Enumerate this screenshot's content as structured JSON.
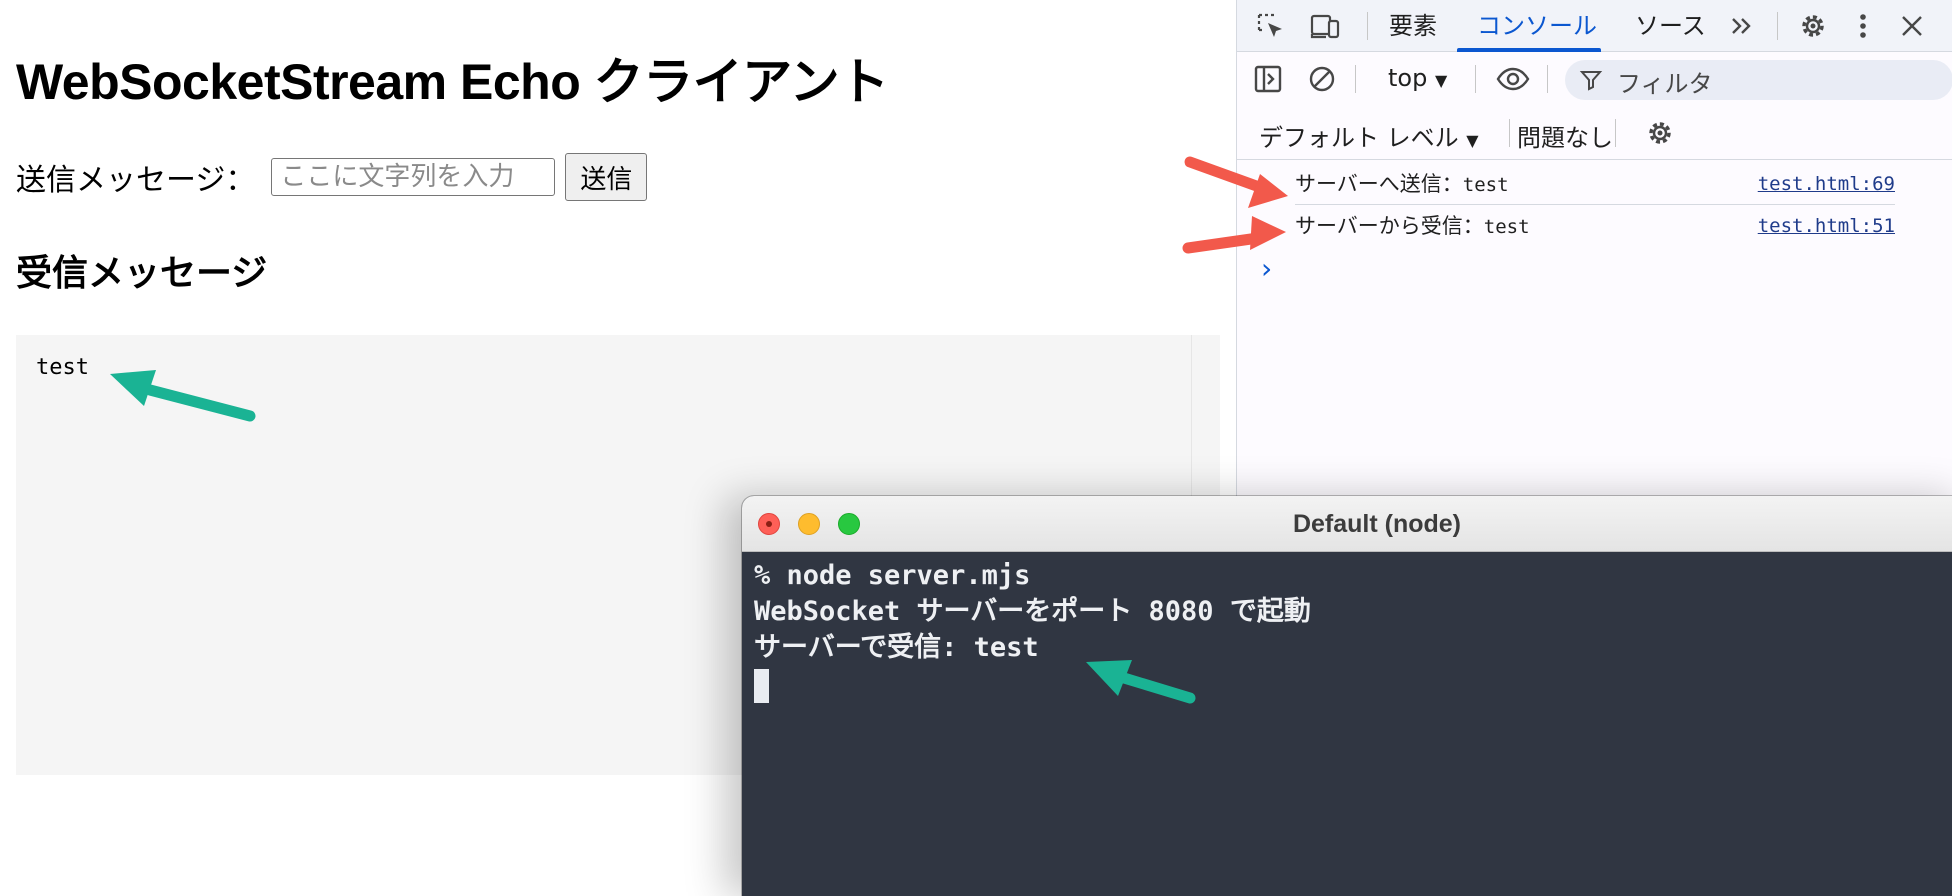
{
  "webpage": {
    "title": "WebSocketStream Echo クライアント",
    "send_label": "送信メッセージ：",
    "input_placeholder": "ここに文字列を入力",
    "send_button": "送信",
    "received_heading": "受信メッセージ",
    "received_text": "test"
  },
  "devtools": {
    "tabs": [
      "要素",
      "コンソール",
      "ソース"
    ],
    "active_tab": "コンソール",
    "context": "top",
    "filter_placeholder": "フィルタ",
    "levels": "デフォルト レベル",
    "issues": "問題なし",
    "logs": [
      {
        "label": "サーバーへ送信：",
        "value": "test",
        "source": "test.html:69"
      },
      {
        "label": "サーバーから受信：",
        "value": "test",
        "source": "test.html:51"
      }
    ],
    "prompt": "›"
  },
  "terminal": {
    "title": "Default (node)",
    "lines": [
      "% node server.mjs",
      "WebSocket サーバーをポート 8080 で起動",
      "サーバーで受信: test"
    ]
  },
  "colors": {
    "devtools_accent": "#0b57d0",
    "arrow_red": "#f2594b",
    "arrow_teal": "#1ab394",
    "terminal_bg": "#303642"
  }
}
